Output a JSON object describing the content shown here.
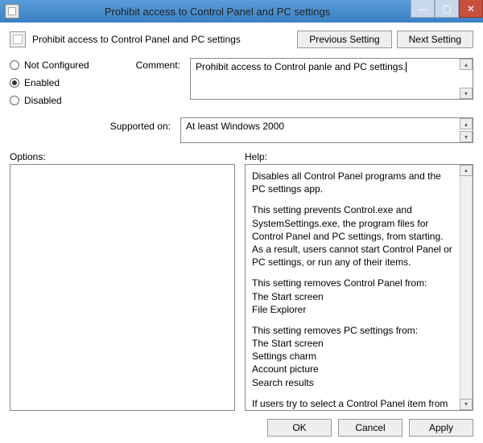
{
  "window": {
    "title": "Prohibit access to Control Panel and PC settings",
    "header_title": "Prohibit access to Control Panel and PC settings"
  },
  "nav": {
    "previous": "Previous Setting",
    "next": "Next Setting"
  },
  "state": {
    "not_configured": "Not Configured",
    "enabled": "Enabled",
    "disabled": "Disabled"
  },
  "labels": {
    "comment": "Comment:",
    "supported": "Supported on:",
    "options": "Options:",
    "help": "Help:"
  },
  "comment_text": "Prohibit access to Control panle and PC settings.",
  "supported_text": "At least Windows 2000",
  "help": {
    "p1": "Disables all Control Panel programs and the PC settings app.",
    "p2": "This setting prevents Control.exe and SystemSettings.exe, the program files for Control Panel and PC settings, from starting. As a result, users cannot start Control Panel or PC settings, or run any of their items.",
    "p3": "This setting removes Control Panel from:",
    "p3a": "The Start screen",
    "p3b": "File Explorer",
    "p4": "This setting removes PC settings from:",
    "p4a": "The Start screen",
    "p4b": "Settings charm",
    "p4c": "Account picture",
    "p4d": "Search results",
    "p5": "If users try to select a Control Panel item from the Properties item on a context menu, a message appears explaining that a setting prevents the action."
  },
  "footer": {
    "ok": "OK",
    "cancel": "Cancel",
    "apply": "Apply"
  }
}
